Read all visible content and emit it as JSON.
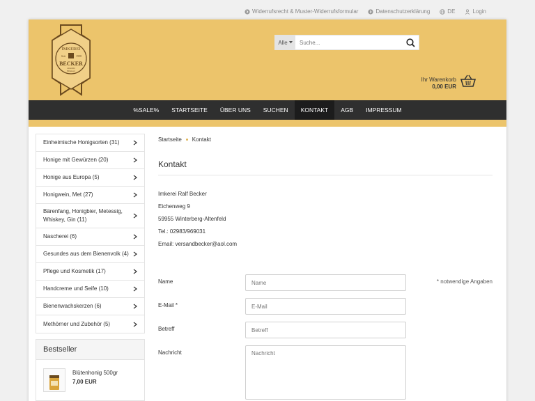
{
  "topbar": {
    "withdrawal": "Widerrufsrecht & Muster-Widerrufsformular",
    "privacy": "Datenschutzerklärung",
    "language": "DE",
    "login": "Login"
  },
  "logo": {
    "line1": "IMKEREI",
    "since": "Seit",
    "year": "1998",
    "name": "BECKER",
    "sub1": "Altenfeld",
    "sub2": "Hillekopf"
  },
  "search": {
    "category": "Alle",
    "placeholder": "Suche..."
  },
  "cart": {
    "label": "Ihr Warenkorb",
    "sum": "0,00 EUR"
  },
  "nav": [
    "%SALE%",
    "STARTSEITE",
    "ÜBER UNS",
    "SUCHEN",
    "KONTAKT",
    "AGB",
    "IMPRESSUM"
  ],
  "sidebar": {
    "categories": [
      "Einheimische Honigsorten (31)",
      "Honige mit Gewürzen (20)",
      "Honige aus Europa (5)",
      "Honigwein, Met (27)",
      "Bärenfang, Honigbier, Metessig, Whiskey, Gin (11)",
      "Nascherei (6)",
      "Gesundes aus dem Bienenvolk (4)",
      "Pflege und Kosmetik (17)",
      "Handcreme und Seife (10)",
      "Bienenwachskerzen (6)",
      "Methörner und Zubehör (5)"
    ],
    "bestseller_title": "Bestseller",
    "bestseller_item": {
      "name": "Blütenhonig 500gr",
      "price": "7,00 EUR"
    }
  },
  "main": {
    "breadcrumb": [
      "Startseite",
      "Kontakt"
    ],
    "title": "Kontakt",
    "address": [
      "Imkerei Ralf Becker",
      "Eichenweg 9",
      "59955 Winterberg-Altenfeld",
      "Tel.: 02983/969031",
      "Email: versandbecker@aol.com"
    ],
    "required_note": "* notwendige Angaben",
    "form": {
      "name_label": "Name",
      "name_placeholder": "Name",
      "email_label": "E-Mail *",
      "email_placeholder": "E-Mail",
      "subject_label": "Betreff",
      "subject_placeholder": "Betreff",
      "message_label": "Nachricht",
      "message_placeholder": "Nachricht"
    }
  },
  "colors": {
    "header_gold": "#ecc46b",
    "nav_dark": "#2f2f2f",
    "logo_brown": "#6b4a1e"
  }
}
